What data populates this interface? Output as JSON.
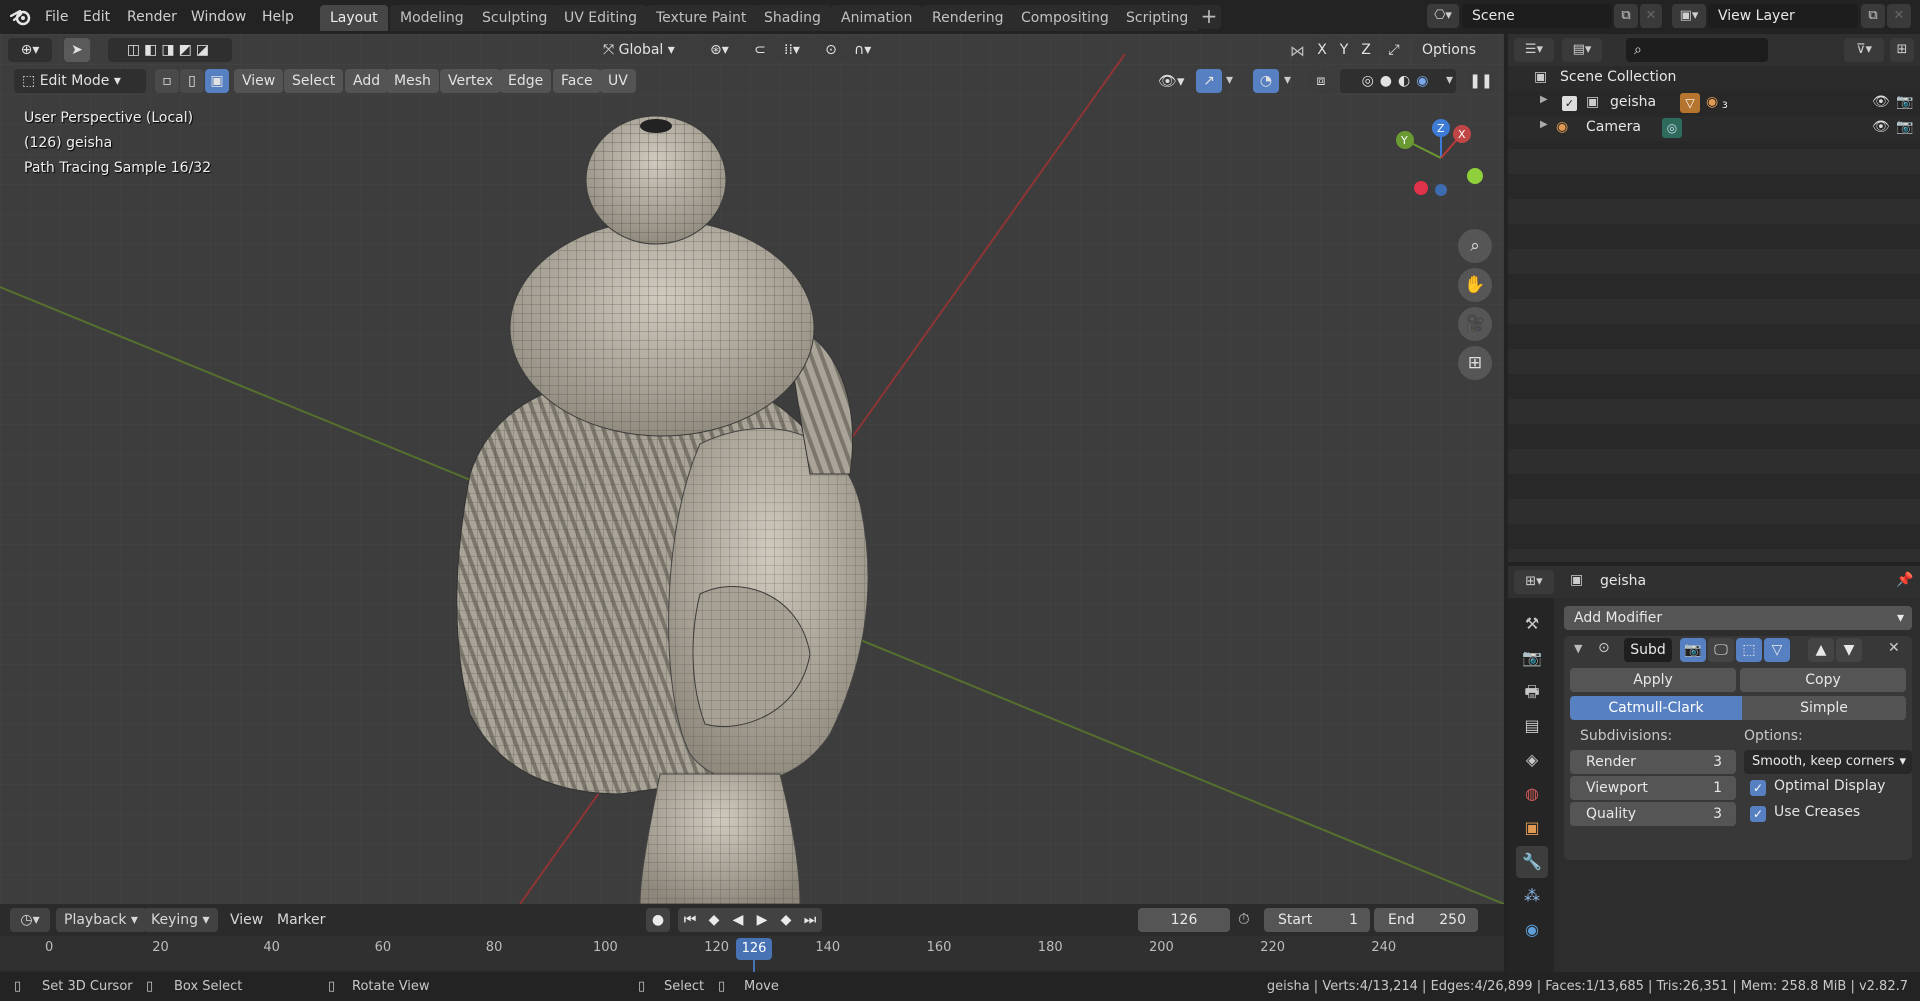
{
  "menu": [
    "File",
    "Edit",
    "Render",
    "Window",
    "Help"
  ],
  "workspaces": [
    "Layout",
    "Modeling",
    "Sculpting",
    "UV Editing",
    "Texture Paint",
    "Shading",
    "Animation",
    "Rendering",
    "Compositing",
    "Scripting"
  ],
  "active_workspace": "Layout",
  "scene_name": "Scene",
  "view_layer": "View Layer",
  "viewport": {
    "transform_orientation": "Global",
    "options_label": "Options",
    "axis_x": "X",
    "axis_y": "Y",
    "axis_z": "Z",
    "mode": "Edit Mode",
    "header_menus": [
      "View",
      "Select",
      "Add",
      "Mesh",
      "Vertex",
      "Edge",
      "Face",
      "UV"
    ],
    "info_line1": "User Perspective (Local)",
    "info_line2": "(126) geisha",
    "info_line3": "Path Tracing Sample 16/32",
    "gizmo_x": "X",
    "gizmo_y": "Y",
    "gizmo_z": "Z"
  },
  "timeline": {
    "menus": [
      "Playback",
      "Keying",
      "View",
      "Marker"
    ],
    "current_frame": "126",
    "start_label": "Start",
    "start": "1",
    "end_label": "End",
    "end": "250",
    "ticks": [
      "0",
      "20",
      "40",
      "60",
      "80",
      "100",
      "120",
      "140",
      "160",
      "180",
      "200",
      "220",
      "240"
    ],
    "playhead": "126"
  },
  "status": {
    "left": [
      "Set 3D Cursor",
      "Box Select",
      "Rotate View",
      "Select",
      "Move"
    ],
    "stats": "geisha | Verts:4/13,214 | Edges:4/26,899 | Faces:1/13,685 | Tris:26,351 | Mem: 258.8 MiB | v2.82.7"
  },
  "outliner": {
    "collection": "Scene Collection",
    "items": [
      {
        "label": "geisha",
        "badge": "3"
      },
      {
        "label": "Camera"
      }
    ]
  },
  "properties": {
    "object_name": "geisha",
    "add_modifier": "Add Modifier",
    "modifier_name": "Subd",
    "apply": "Apply",
    "copy": "Copy",
    "catmull": "Catmull-Clark",
    "simple": "Simple",
    "subdivisions_label": "Subdivisions:",
    "options_label": "Options:",
    "render_label": "Render",
    "render_value": "3",
    "viewport_label": "Viewport",
    "viewport_value": "1",
    "quality_label": "Quality",
    "quality_value": "3",
    "uv_smooth": "Smooth, keep corners",
    "optimal_display": "Optimal Display",
    "use_creases": "Use Creases"
  },
  "colors": {
    "accent": "#5680c2",
    "x_axis": "#b83a3a",
    "y_axis": "#6a9b32",
    "z_axis": "#3d7bd6"
  }
}
